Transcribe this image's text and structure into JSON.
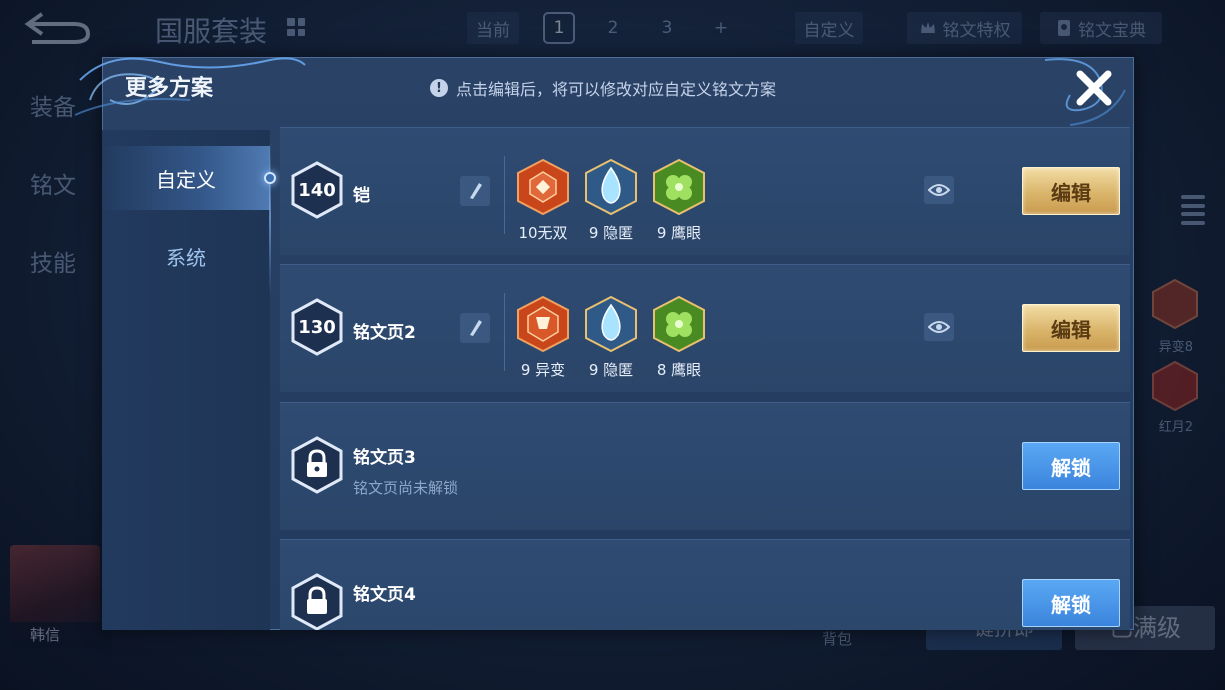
{
  "background": {
    "title": "国服套装",
    "current_label": "当前",
    "page_tabs": [
      "1",
      "2",
      "3",
      "+"
    ],
    "custom_label": "自定义",
    "privilege_label": "铭文特权",
    "codex_label": "铭文宝典",
    "side_tabs": [
      "装备",
      "铭文",
      "技能"
    ],
    "rune_labels": [
      "异变8",
      "红月2"
    ],
    "hero_name": "韩信",
    "bag_label": "背包",
    "button1_label": "一键拼即",
    "button2_label": "已满级"
  },
  "dialog": {
    "title": "更多方案",
    "hint": "点击编辑后，将可以修改对应自定义铭文方案",
    "nav": [
      "自定义",
      "系统"
    ],
    "pages": [
      {
        "level": "140",
        "name": "铠",
        "runes": [
          {
            "label": "10无双",
            "color": "#d9541f"
          },
          {
            "label": "9 隐匿",
            "color": "#7fc7ec"
          },
          {
            "label": "9 鹰眼",
            "color": "#7fbf3a"
          }
        ],
        "action": "编辑"
      },
      {
        "level": "130",
        "name": "铭文页2",
        "runes": [
          {
            "label": "9 异变",
            "color": "#d9541f"
          },
          {
            "label": "9 隐匿",
            "color": "#7fc7ec"
          },
          {
            "label": "8 鹰眼",
            "color": "#7fbf3a"
          }
        ],
        "action": "编辑"
      },
      {
        "name": "铭文页3",
        "status": "铭文页尚未解锁",
        "action": "解锁"
      },
      {
        "name": "铭文页4",
        "action": "解锁"
      }
    ]
  },
  "colors": {
    "edit_button": "#d9b56b",
    "unlock_button": "#3b84dc",
    "panel": "#2a4266"
  }
}
